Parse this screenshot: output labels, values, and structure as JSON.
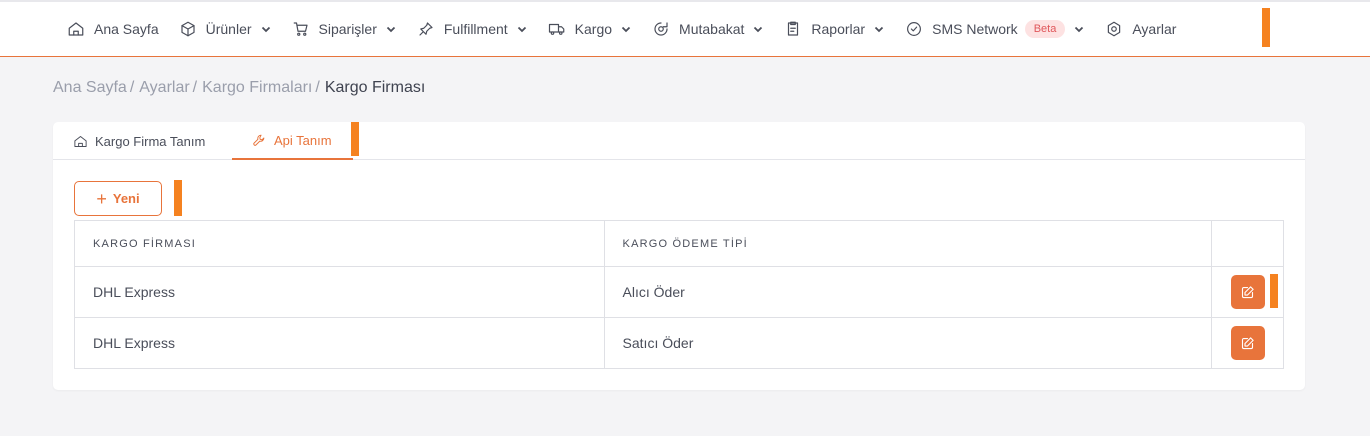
{
  "nav": {
    "items": [
      {
        "label": "Ana Sayfa",
        "icon": "home-icon",
        "has_dropdown": false
      },
      {
        "label": "Ürünler",
        "icon": "box-icon",
        "has_dropdown": true
      },
      {
        "label": "Siparişler",
        "icon": "cart-icon",
        "has_dropdown": true
      },
      {
        "label": "Fulfillment",
        "icon": "pin-icon",
        "has_dropdown": true
      },
      {
        "label": "Kargo",
        "icon": "truck-icon",
        "has_dropdown": true
      },
      {
        "label": "Mutabakat",
        "icon": "eye-icon",
        "has_dropdown": true
      },
      {
        "label": "Raporlar",
        "icon": "report-icon",
        "has_dropdown": true
      },
      {
        "label": "SMS Network",
        "icon": "check-circle-icon",
        "has_dropdown": true,
        "badge": "Beta"
      },
      {
        "label": "Ayarlar",
        "icon": "settings-icon",
        "has_dropdown": false
      }
    ]
  },
  "breadcrumb": {
    "items": [
      "Ana Sayfa",
      "Ayarlar",
      "Kargo Firmaları"
    ],
    "current": "Kargo Firması"
  },
  "tabs": [
    {
      "label": "Kargo Firma Tanım",
      "icon": "home-icon",
      "active": false
    },
    {
      "label": "Api Tanım",
      "icon": "wrench-icon",
      "active": true
    }
  ],
  "new_button": {
    "label": "Yeni"
  },
  "table": {
    "headers": [
      "KARGO FİRMASI",
      "KARGO ÖDEME TİPİ"
    ],
    "rows": [
      {
        "firm": "DHL Express",
        "payment": "Alıcı Öder"
      },
      {
        "firm": "DHL Express",
        "payment": "Satıcı Öder"
      }
    ]
  },
  "colors": {
    "accent": "#e8743b",
    "marker": "#f58220",
    "badge_bg": "#fde2e2",
    "badge_text": "#e0575b"
  }
}
